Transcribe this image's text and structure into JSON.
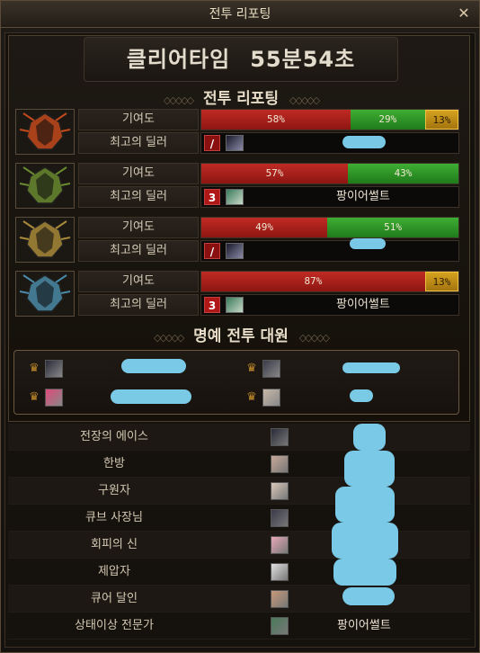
{
  "window": {
    "title": "전투 리포팅",
    "close": "✕"
  },
  "clear_time": {
    "label": "클리어타임",
    "value": "55분54초"
  },
  "report_section_title": "전투 리포팅",
  "honor_section_title": "명예 전투 대원",
  "reports": [
    {
      "contribution_label": "기여도",
      "segments": [
        {
          "color": "red",
          "text": "58%",
          "pct": 58
        },
        {
          "color": "green",
          "text": "29%",
          "pct": 29
        },
        {
          "color": "gold",
          "text": "13%",
          "pct": 13
        }
      ],
      "dealer_label": "최고의 딜러",
      "dealer_class": "/",
      "dealer_name": "",
      "portrait": "flame-guardian-icon",
      "accent": "#c24a1c"
    },
    {
      "contribution_label": "기여도",
      "segments": [
        {
          "color": "red",
          "text": "57%",
          "pct": 57
        },
        {
          "color": "green",
          "text": "43%",
          "pct": 43
        }
      ],
      "dealer_label": "최고의 딜러",
      "dealer_class": "3",
      "dealer_name": "팡이어썰트",
      "portrait": "forest-guardian-icon",
      "accent": "#6a8a30"
    },
    {
      "contribution_label": "기여도",
      "segments": [
        {
          "color": "red",
          "text": "49%",
          "pct": 49
        },
        {
          "color": "green",
          "text": "51%",
          "pct": 51
        }
      ],
      "dealer_label": "최고의 딜러",
      "dealer_class": "/",
      "dealer_name": "",
      "portrait": "gold-guardian-icon",
      "accent": "#a88a3a"
    },
    {
      "contribution_label": "기여도",
      "segments": [
        {
          "color": "red",
          "text": "87%",
          "pct": 87
        },
        {
          "color": "gold",
          "text": "13%",
          "pct": 13
        }
      ],
      "dealer_label": "최고의 딜러",
      "dealer_class": "3",
      "dealer_name": "팡이어썰트",
      "portrait": "ice-guardian-icon",
      "accent": "#4a8aa8"
    }
  ],
  "honor_members": [
    {
      "crown": "♛",
      "face_color": "#2a2a3a"
    },
    {
      "crown": "♛",
      "face_color": "#3a3a4a"
    },
    {
      "crown": "♛",
      "face_color": "#e04a7a"
    },
    {
      "crown": "♛",
      "face_color": "#c8b8a8"
    }
  ],
  "awards": [
    {
      "label": "전장의 에이스",
      "name": "",
      "face_color": "#2a2a3a"
    },
    {
      "label": "한방",
      "name": "",
      "face_color": "#c8a898"
    },
    {
      "label": "구원자",
      "name": "",
      "face_color": "#d8c8b8"
    },
    {
      "label": "큐브 사장님",
      "name": "",
      "face_color": "#3a3a4a"
    },
    {
      "label": "회피의 신",
      "name": "",
      "face_color": "#e8a8b8"
    },
    {
      "label": "제압자",
      "name": "",
      "face_color": "#e0e0e0"
    },
    {
      "label": "큐어 달인",
      "name": "",
      "face_color": "#c89878"
    },
    {
      "label": "상태이상 전문가",
      "name": "팡이어썰트",
      "face_color": "#4a7a5a"
    }
  ]
}
